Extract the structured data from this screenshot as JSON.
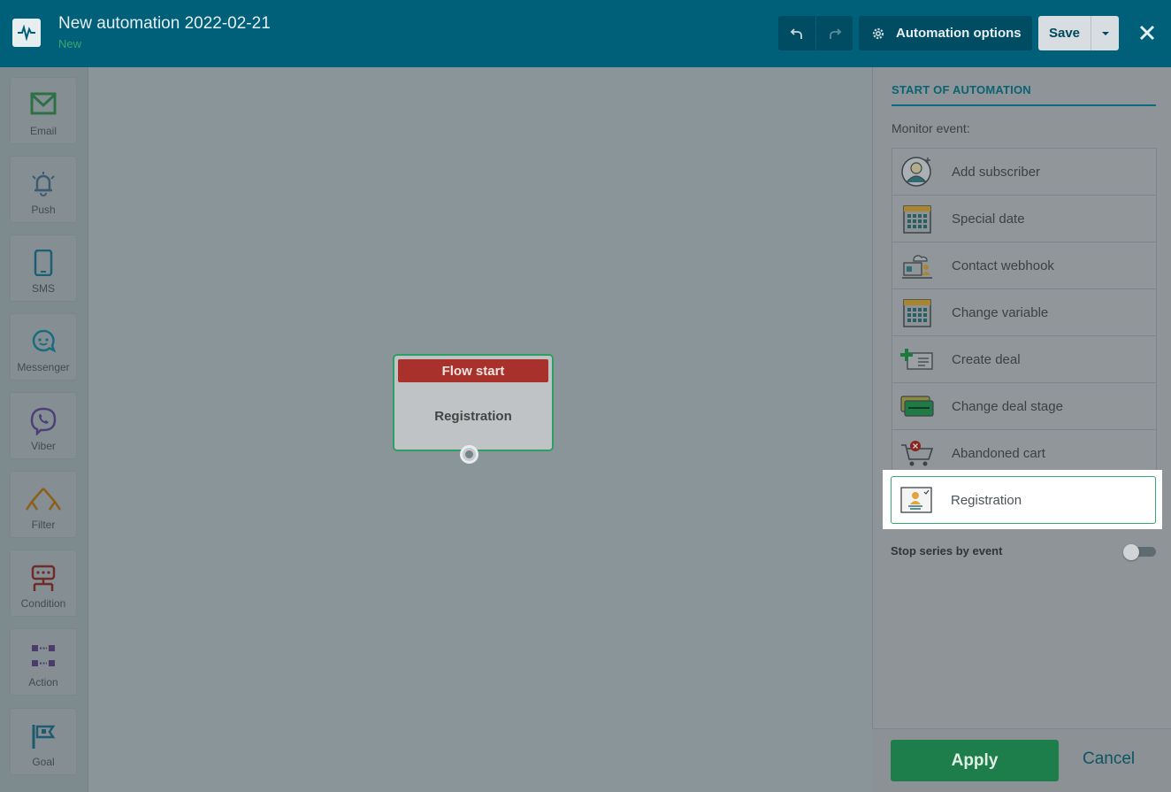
{
  "header": {
    "title": "New automation 2022-02-21",
    "status": "New",
    "options_label": "Automation options",
    "save_label": "Save"
  },
  "toolbar": {
    "items": [
      {
        "label": "Email",
        "icon": "email-icon"
      },
      {
        "label": "Push",
        "icon": "bell-icon"
      },
      {
        "label": "SMS",
        "icon": "phone-icon"
      },
      {
        "label": "Messenger",
        "icon": "chat-icon"
      },
      {
        "label": "Viber",
        "icon": "viber-icon"
      },
      {
        "label": "Filter",
        "icon": "filter-icon"
      },
      {
        "label": "Condition",
        "icon": "condition-icon"
      },
      {
        "label": "Action",
        "icon": "action-icon"
      },
      {
        "label": "Goal",
        "icon": "flag-icon"
      }
    ]
  },
  "canvas": {
    "node": {
      "header": "Flow start",
      "body": "Registration"
    }
  },
  "panel": {
    "title": "START OF AUTOMATION",
    "monitor_label": "Monitor event:",
    "events": [
      {
        "label": "Add subscriber",
        "icon": "add-subscriber-icon"
      },
      {
        "label": "Special date",
        "icon": "calendar-icon"
      },
      {
        "label": "Contact webhook",
        "icon": "webhook-icon"
      },
      {
        "label": "Change variable",
        "icon": "calendar-icon"
      },
      {
        "label": "Create deal",
        "icon": "create-deal-icon"
      },
      {
        "label": "Change deal stage",
        "icon": "deal-stage-icon"
      },
      {
        "label": "Abandoned cart",
        "icon": "cart-icon"
      }
    ],
    "selected_event": {
      "label": "Registration",
      "icon": "registration-icon"
    },
    "stop_series_label": "Stop series by event",
    "apply_label": "Apply",
    "cancel_label": "Cancel"
  },
  "colors": {
    "header_bg": "#005f79",
    "accent_green": "#1e7e4b",
    "flow_start_red": "#a8322b"
  }
}
